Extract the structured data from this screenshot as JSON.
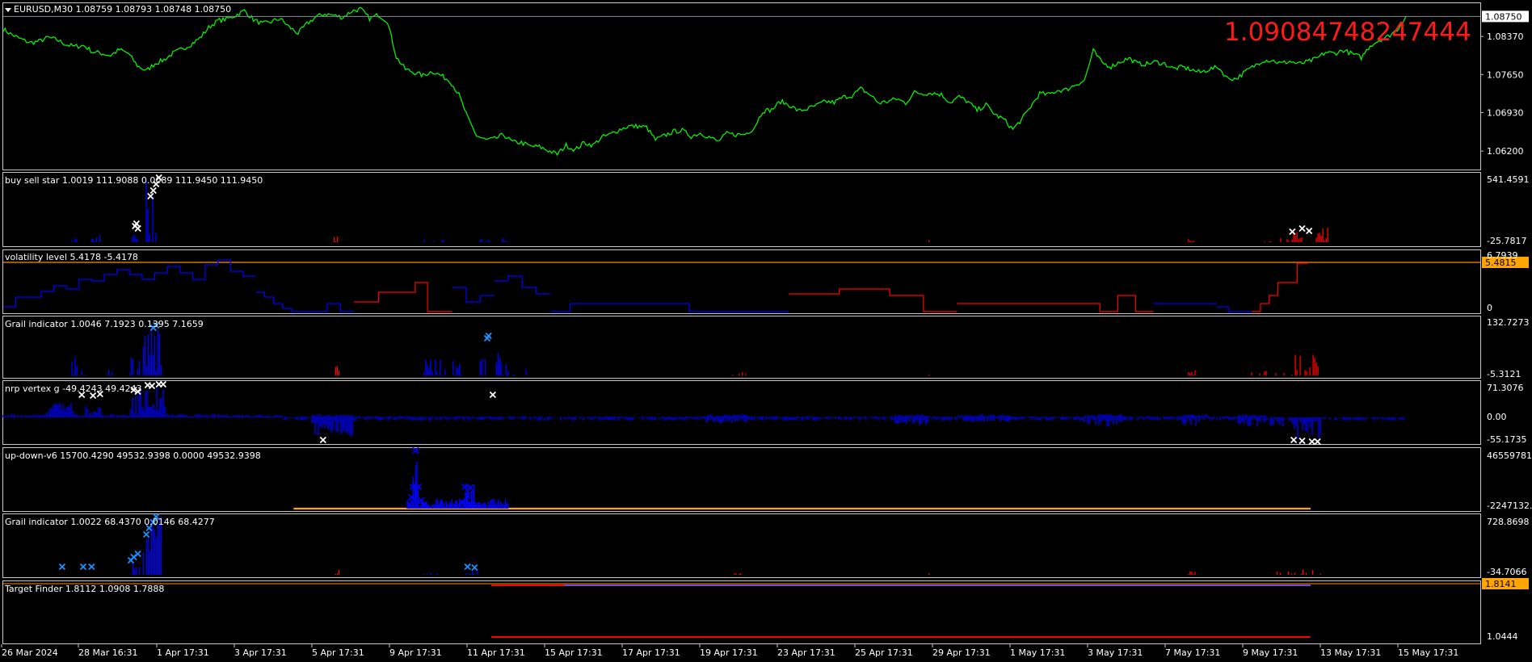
{
  "chart_data": [
    {
      "type": "line",
      "title": "EURUSD,M30  1.08759 1.08793 1.08748 1.08750",
      "symbol": "EURUSD",
      "timeframe": "M30",
      "ohlc": [
        "1.08759",
        "1.08793",
        "1.08748",
        "1.08750"
      ],
      "big_label": "1.09084748247444",
      "y_ticks": [
        "1.08370",
        "1.07650",
        "1.06930",
        "1.06200"
      ],
      "y_tick_values": [
        1.0837,
        1.0765,
        1.0693,
        1.062
      ],
      "current_price_label": "1.08750",
      "ylim": [
        1.0585,
        1.09
      ],
      "series": [
        {
          "color": "#00ff00",
          "values": [
            1.0851,
            1.084,
            1.0832,
            1.0825,
            1.0828,
            1.0835,
            1.0831,
            1.0822,
            1.0818,
            1.082,
            1.0808,
            1.0805,
            1.0801,
            1.0812,
            1.0805,
            1.0782,
            1.0772,
            1.0786,
            1.0793,
            1.0805,
            1.0813,
            1.0822,
            1.0834,
            1.0854,
            1.0867,
            1.087,
            1.0877,
            1.0886,
            1.0869,
            1.0861,
            1.0865,
            1.0871,
            1.0855,
            1.0843,
            1.0861,
            1.0874,
            1.088,
            1.0877,
            1.0873,
            1.0885,
            1.0889,
            1.0871,
            1.0878,
            1.0866,
            1.0798,
            1.0775,
            1.0769,
            1.0763,
            1.0771,
            1.0763,
            1.0753,
            1.0727,
            1.0682,
            1.0649,
            1.0641,
            1.0643,
            1.0651,
            1.0637,
            1.0636,
            1.0629,
            1.0628,
            1.0621,
            1.0614,
            1.0631,
            1.0622,
            1.0636,
            1.0631,
            1.0646,
            1.0652,
            1.0661,
            1.0667,
            1.0667,
            1.0665,
            1.0641,
            1.0649,
            1.0657,
            1.0659,
            1.0648,
            1.0654,
            1.0647,
            1.0638,
            1.0653,
            1.0651,
            1.0652,
            1.0663,
            1.0696,
            1.0698,
            1.0714,
            1.0707,
            1.0696,
            1.07,
            1.0706,
            1.0714,
            1.0712,
            1.0722,
            1.0725,
            1.0738,
            1.0727,
            1.0711,
            1.0714,
            1.0719,
            1.0711,
            1.0731,
            1.0729,
            1.073,
            1.0727,
            1.0712,
            1.0723,
            1.0713,
            1.0697,
            1.0708,
            1.0689,
            1.068,
            1.0661,
            1.068,
            1.0704,
            1.0729,
            1.0727,
            1.0735,
            1.0736,
            1.0746,
            1.0753,
            1.081,
            1.0787,
            1.078,
            1.0789,
            1.0796,
            1.0785,
            1.0785,
            1.0789,
            1.0785,
            1.0776,
            1.0779,
            1.0774,
            1.0769,
            1.0775,
            1.0779,
            1.0758,
            1.0757,
            1.077,
            1.0781,
            1.0792,
            1.0792,
            1.0786,
            1.079,
            1.0785,
            1.0789,
            1.0795,
            1.0807,
            1.0805,
            1.0811,
            1.0804,
            1.0797,
            1.082,
            1.083,
            1.0837,
            1.085,
            1.0875
          ]
        }
      ]
    },
    {
      "type": "bar",
      "title": "buy sell star 1.0019 111.9088 0.0089 111.9450 111.9450",
      "y_ticks": [
        "541.4591",
        "-25.7817"
      ],
      "ylim": [
        -25.7817,
        541.4591
      ],
      "notes": "blue buy bars, red sell bars, white x markers"
    },
    {
      "type": "line",
      "title": "volatility level 5.4178 -5.4178",
      "y_ticks": [
        "6.7939",
        "0"
      ],
      "level_label": "5.4815",
      "ylim": [
        -0.5,
        6.7939
      ]
    },
    {
      "type": "bar",
      "title": "Grail indicator 1.0046 7.1923 0.1395 7.1659",
      "y_ticks": [
        "132.7273",
        "-5.3121"
      ],
      "ylim": [
        -5.3121,
        132.7273
      ]
    },
    {
      "type": "bar",
      "title": "nrp vertex g -49.4243 49.4243",
      "y_ticks": [
        "71.3076",
        "0.00",
        "-55.1735"
      ],
      "ylim": [
        -55.1735,
        71.3076
      ]
    },
    {
      "type": "bar",
      "title": "up-down-v6 15700.4290 49532.9398 0.0000 49532.9398",
      "y_ticks": [
        "46559781.",
        "-2247132.4"
      ],
      "ylim": [
        -2247132.4,
        46559781
      ]
    },
    {
      "type": "bar",
      "title": "Grail indicator 1.0022 68.4370 0.0146 68.4277",
      "y_ticks": [
        "728.8698",
        "-34.7066"
      ],
      "ylim": [
        -34.7066,
        728.8698
      ]
    },
    {
      "type": "line",
      "title": "Target Finder 1.8112 1.0908 1.7888",
      "y_ticks": [
        "1.0444"
      ],
      "level_label": "1.8141",
      "ylim": [
        1.0,
        1.85
      ]
    }
  ],
  "x_axis": {
    "labels": [
      "26 Mar 2024",
      "28 Mar 16:31",
      "1 Apr 17:31",
      "3 Apr 17:31",
      "5 Apr 17:31",
      "9 Apr 17:31",
      "11 Apr 17:31",
      "15 Apr 17:31",
      "17 Apr 17:31",
      "19 Apr 17:31",
      "23 Apr 17:31",
      "25 Apr 17:31",
      "29 Apr 17:31",
      "1 May 17:31",
      "3 May 17:31",
      "7 May 17:31",
      "9 May 17:31",
      "13 May 17:31",
      "15 May 17:31"
    ]
  },
  "colors": {
    "price": "#00ff00",
    "buy": "#0000ff",
    "sell": "#ff0000",
    "marker": "#ffffff",
    "grail_marker": "#1e90ff",
    "level": "#ff8c00",
    "price_tag": "#ffa500"
  }
}
